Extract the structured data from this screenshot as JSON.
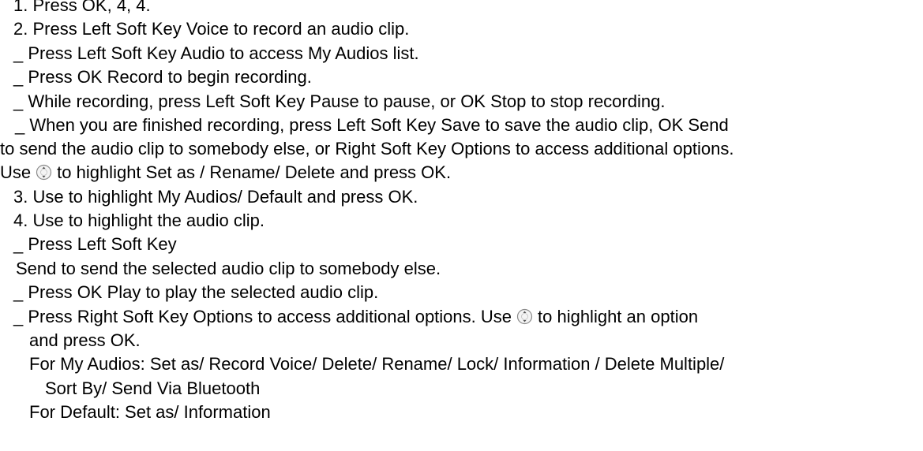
{
  "lines": {
    "l0": "1. Press OK, 4, 4.",
    "l1": "2. Press Left Soft Key Voice to record an audio clip.",
    "l2": "_ Press Left Soft Key Audio to access My Audios list.",
    "l3": "_ Press OK Record to begin recording.",
    "l4": "_ While recording, press Left Soft Key Pause to pause, or OK Stop to stop recording.",
    "l5": "_ When you are finished recording, press Left Soft Key Save to save the audio clip, OK Send",
    "l6": "to send the audio clip to somebody else, or Right Soft Key Options to access additional options.",
    "l7a": "Use",
    "l7b": "to highlight Set as / Rename/ Delete and press OK.",
    "l8": "3. Use to highlight My Audios/ Default and press OK.",
    "l9": "4. Use to highlight the audio clip.",
    "l10": "_ Press Left Soft Key",
    "l11": "Send to send the selected audio clip to somebody else.",
    "l12": "_ Press OK Play to play the selected audio clip.",
    "l13a": "_ Press Right Soft Key Options to access additional options. Use",
    "l13b": "to highlight an option",
    "l14": "and press OK.",
    "l15": "For My Audios: Set as/ Record Voice/ Delete/ Rename/ Lock/ Information / Delete Multiple/",
    "l16": "Sort By/ Send Via Bluetooth",
    "l17": "For Default: Set as/ Information"
  },
  "icons": {
    "nav_key": "navigation-key-icon"
  }
}
